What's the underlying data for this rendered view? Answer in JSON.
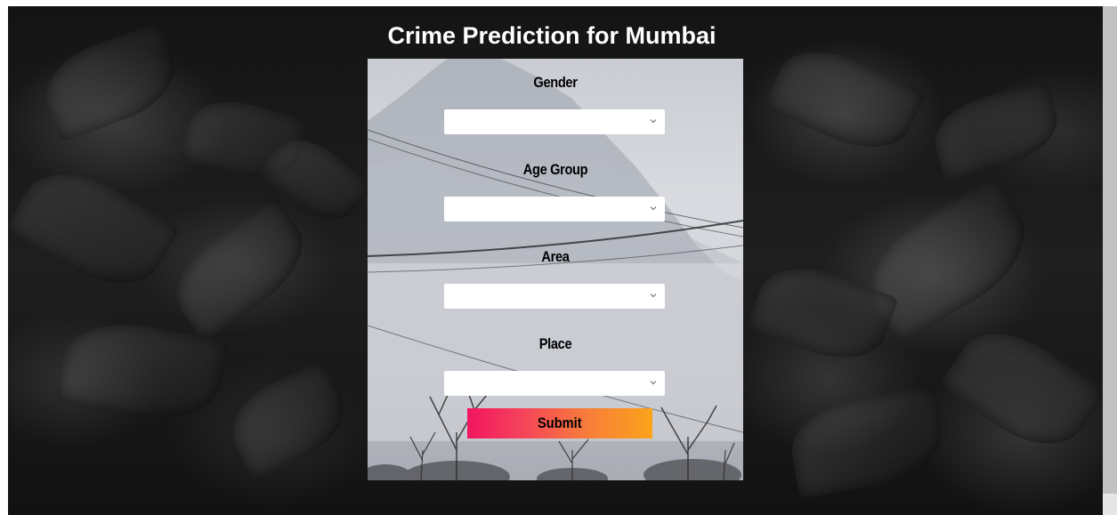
{
  "page": {
    "title": "Crime Prediction for Mumbai"
  },
  "form": {
    "fields": [
      {
        "label": "Gender",
        "value": ""
      },
      {
        "label": "Age Group",
        "value": ""
      },
      {
        "label": "Area",
        "value": ""
      },
      {
        "label": "Place",
        "value": ""
      }
    ],
    "submit_label": "Submit"
  },
  "colors": {
    "title_text": "#ffffff",
    "submit_gradient_start": "#f21560",
    "submit_gradient_end": "#fba31a",
    "page_background": "#1a1a1a"
  }
}
